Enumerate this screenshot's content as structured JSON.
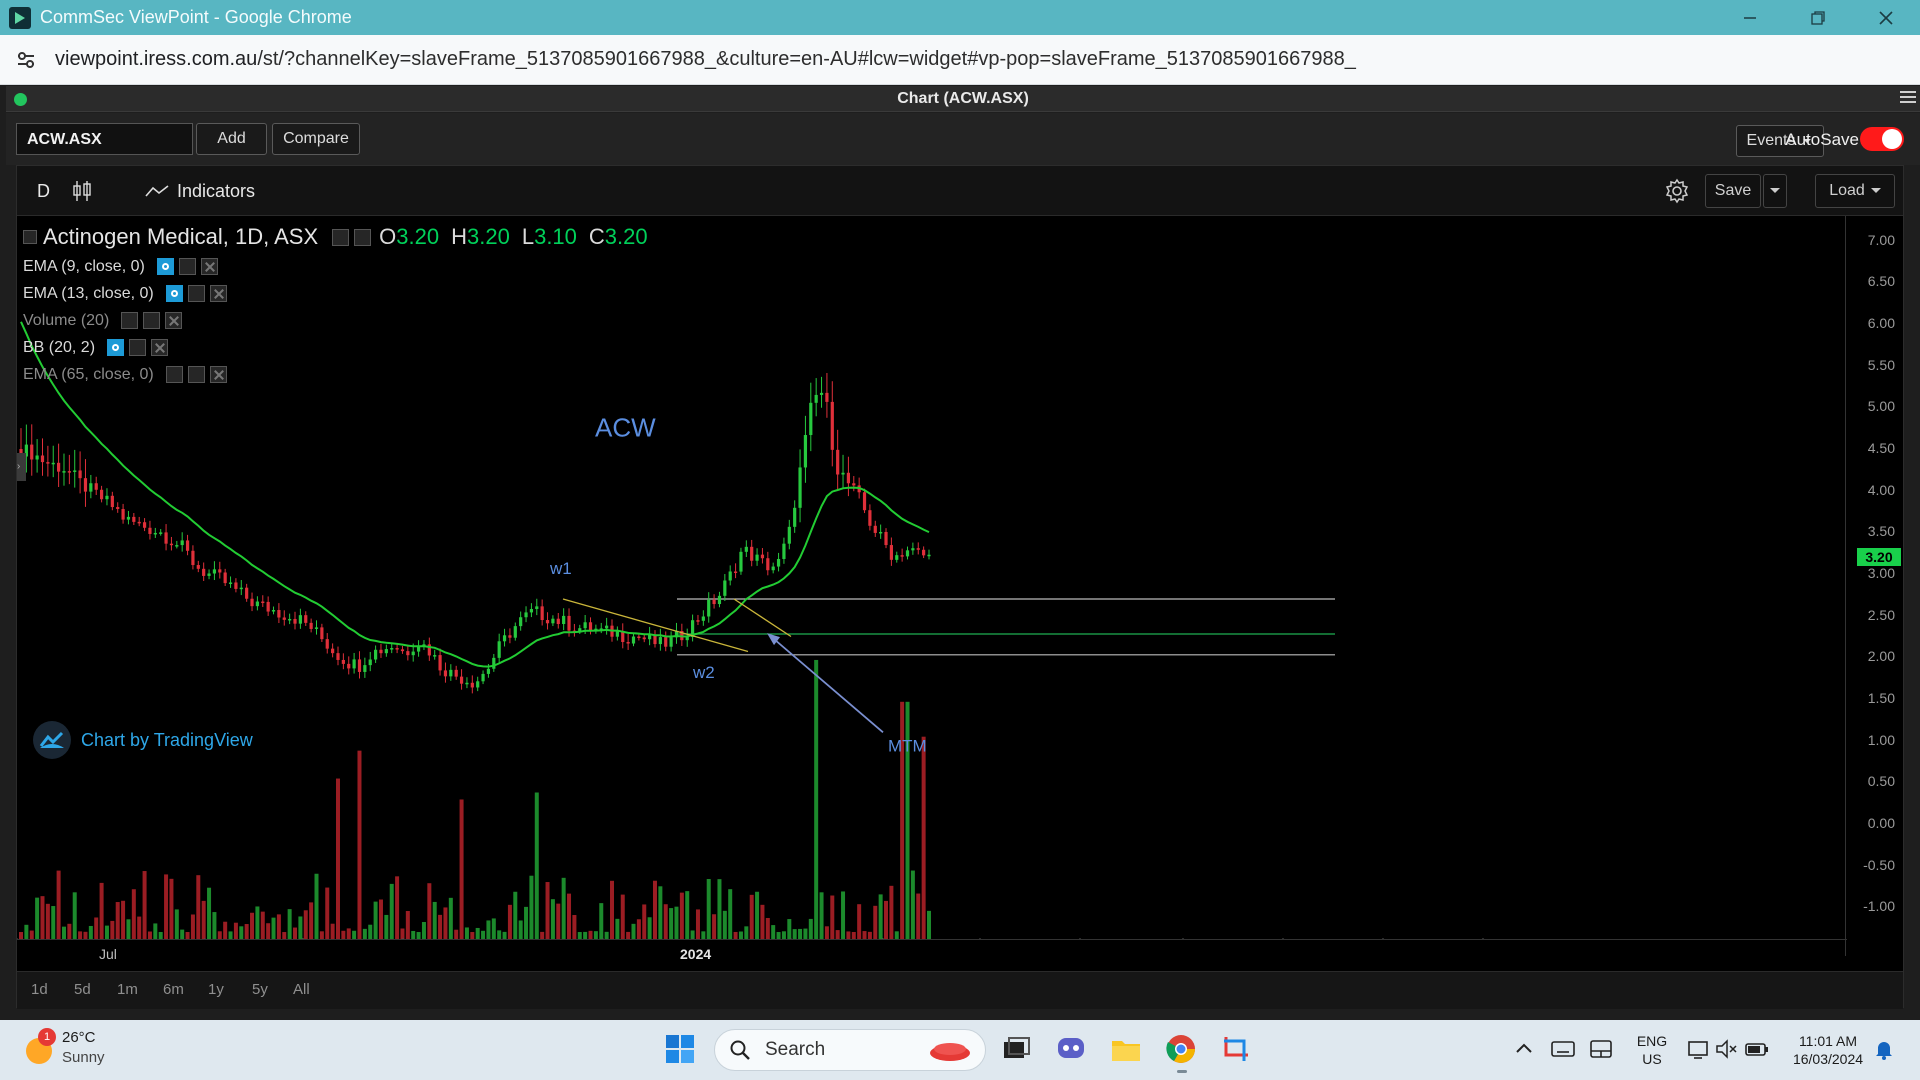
{
  "browser": {
    "title": "CommSec ViewPoint - Google Chrome",
    "url_host": "viewpoint.iress.com.au",
    "url_path": "/st/?channelKey=slaveFrame_5137085901667988_&culture=en-AU#lcw=widget#vp-pop=slaveFrame_5137085901667988_"
  },
  "app": {
    "header_title": "Chart (ACW.ASX)",
    "symbol_value": "ACW.ASX",
    "add_label": "Add",
    "compare_label": "Compare",
    "events_label": "Events",
    "autosave_label": "AutoSave",
    "autosave_on": true
  },
  "chart_toolbar": {
    "interval": "D",
    "indicators_label": "Indicators",
    "save_label": "Save",
    "load_label": "Load"
  },
  "legend": {
    "title": "Actinogen Medical, 1D, ASX",
    "o_label": "O",
    "o_value": "3.20",
    "h_label": "H",
    "h_value": "3.20",
    "l_label": "L",
    "l_value": "3.10",
    "c_label": "C",
    "c_value": "3.20",
    "indicators": [
      "EMA (9, close, 0)",
      "EMA (13, close, 0)",
      "Volume (20)",
      "BB (20, 2)",
      "EMA (65, close, 0)"
    ]
  },
  "annotations": {
    "acw": "ACW",
    "w1": "w1",
    "w2": "w2",
    "mtm": "MTM"
  },
  "watermark": "Chart by TradingView",
  "range_buttons": [
    "1d",
    "5d",
    "1m",
    "6m",
    "1y",
    "5y",
    "All"
  ],
  "chart_data": {
    "type": "candlestick",
    "title": "Actinogen Medical, 1D, ASX",
    "ylim": [
      -1.2,
      7.2
    ],
    "y_ticks": [
      "7.00",
      "6.50",
      "6.00",
      "5.50",
      "5.00",
      "4.50",
      "4.00",
      "3.50",
      "3.00",
      "2.50",
      "2.00",
      "1.50",
      "1.00",
      "0.50",
      "0.00",
      "-0.50",
      "-1.00"
    ],
    "x_labels": [
      "Jul",
      "2024"
    ],
    "last_price": "3.20",
    "horizontal_levels": [
      2.7,
      2.28,
      2.03
    ],
    "close_path": [
      4.5,
      4.45,
      4.35,
      4.3,
      4.25,
      4.1,
      4.0,
      3.9,
      3.8,
      3.65,
      3.6,
      3.55,
      3.5,
      3.4,
      3.3,
      3.1,
      3.0,
      2.95,
      2.85,
      2.75,
      2.65,
      2.6,
      2.55,
      2.5,
      2.45,
      2.35,
      2.2,
      2.05,
      1.95,
      1.9,
      2.05,
      2.1,
      2.15,
      2.05,
      2.2,
      2.1,
      1.9,
      1.8,
      1.75,
      1.7,
      1.85,
      2.1,
      2.3,
      2.45,
      2.55,
      2.5,
      2.45,
      2.4,
      2.35,
      2.35,
      2.3,
      2.3,
      2.25,
      2.25,
      2.2,
      2.15,
      2.2,
      2.3,
      2.45,
      2.6,
      2.75,
      3.0,
      3.3,
      3.2,
      3.1,
      3.1,
      3.5,
      4.3,
      5.1,
      5.2,
      4.3,
      4.1,
      3.9,
      3.6,
      3.4,
      3.2,
      3.3,
      3.25,
      3.2
    ],
    "series": [
      {
        "name": "EMA (65, close, 0)",
        "color": "#22cc33"
      }
    ],
    "volume_range": [
      0,
      2.1
    ]
  },
  "taskbar": {
    "temp": "26°C",
    "weather": "Sunny",
    "weather_badge": "1",
    "search_label": "Search",
    "lang1": "ENG",
    "lang2": "US",
    "time": "11:01 AM",
    "date": "16/03/2024"
  }
}
